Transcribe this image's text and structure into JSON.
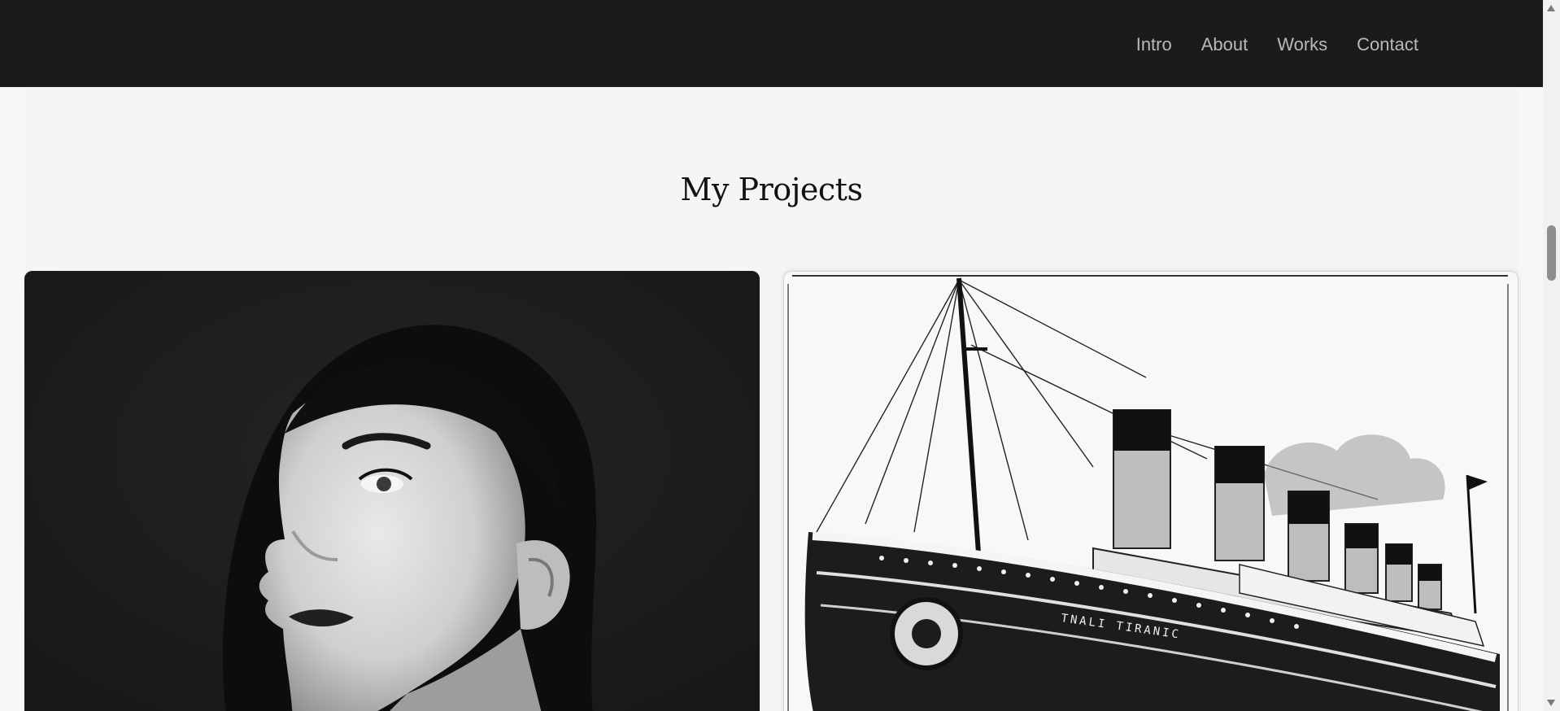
{
  "nav": {
    "links": [
      {
        "label": "Intro"
      },
      {
        "label": "About"
      },
      {
        "label": "Works"
      },
      {
        "label": "Contact"
      }
    ]
  },
  "projects": {
    "title": "My Projects",
    "cards": [
      {
        "image": "black-and-white portrait of a woman looking up"
      },
      {
        "image": "black-and-white illustration of an ocean liner"
      }
    ],
    "ship_hull_text": "TNALI TIRANIC"
  },
  "colors": {
    "navbar_bg": "#1b1b1b",
    "nav_text": "#b9b9b9",
    "page_bg": "#f5f5f5",
    "title_text": "#111111"
  }
}
